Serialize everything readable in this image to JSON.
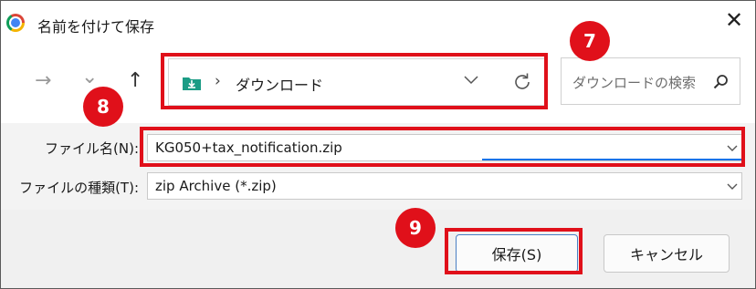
{
  "window": {
    "title": "名前を付けて保存",
    "close_glyph": "✕"
  },
  "nav": {
    "back_glyph": "←",
    "forward_glyph": "→",
    "recent_glyph": "⌄",
    "up_glyph": "↑",
    "breadcrumb_separator": "›",
    "current_folder": "ダウンロード",
    "search_placeholder": "ダウンロードの検索"
  },
  "form": {
    "file_name_label": "ファイル名(N):",
    "file_name_value": "KG050+tax_notification.zip",
    "file_type_label": "ファイルの種類(T):",
    "file_type_value": "zip Archive (*.zip)"
  },
  "buttons": {
    "save_label": "保存(S)",
    "cancel_label": "キャンセル"
  },
  "annotations": {
    "step_address": "7",
    "step_filename": "8",
    "step_save": "9",
    "highlight_color": "#e0101a"
  },
  "icons": [
    "chrome-logo",
    "back-arrow-icon",
    "forward-arrow-icon",
    "recent-dropdown-icon",
    "up-arrow-icon",
    "download-folder-icon",
    "chevron-down-icon",
    "refresh-icon",
    "search-icon",
    "close-icon"
  ],
  "colors": {
    "accent": "#1a73e8",
    "annotation_red": "#e0101a"
  }
}
